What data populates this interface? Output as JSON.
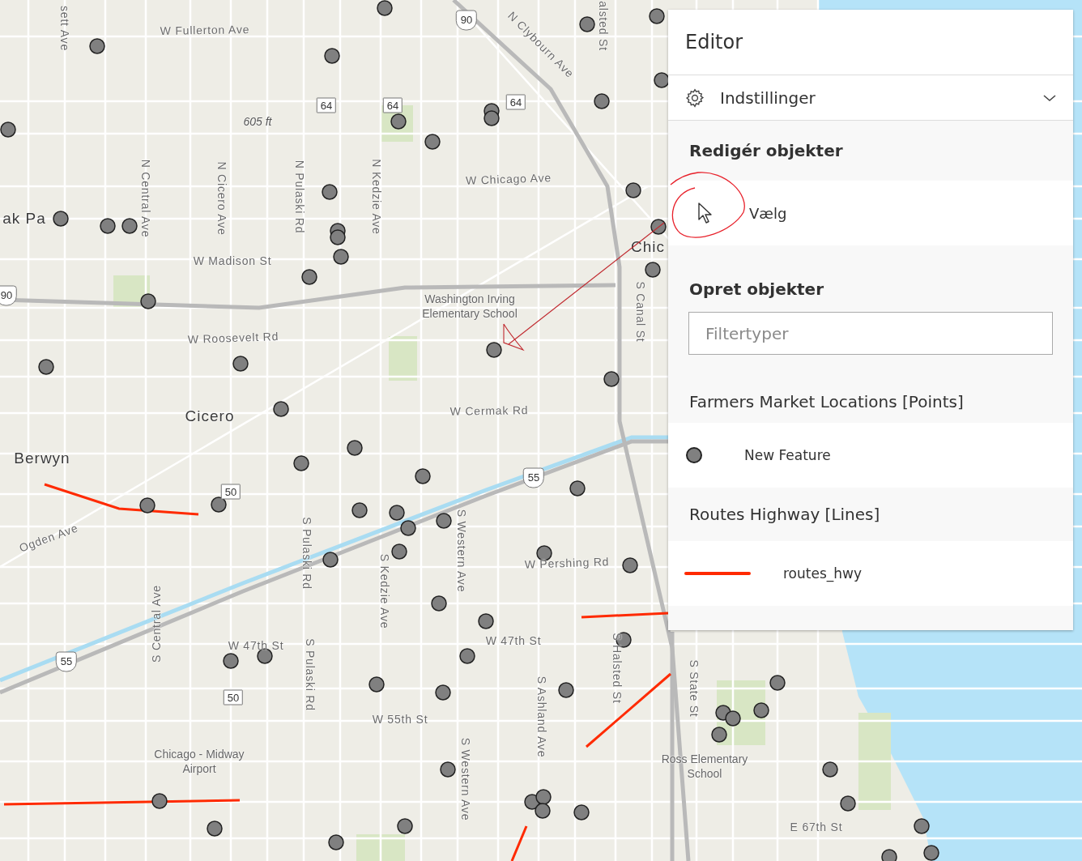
{
  "map": {
    "labels": [
      {
        "text": "sett Ave",
        "kind": "street"
      },
      {
        "text": "W Fullerton Ave",
        "kind": "street"
      },
      {
        "text": "N Clybourn Ave",
        "kind": "street"
      },
      {
        "text": "alsted St",
        "kind": "street"
      },
      {
        "text": "605 ft",
        "kind": "elevation"
      },
      {
        "text": "W Chicago Ave",
        "kind": "street"
      },
      {
        "text": "ak Pa",
        "kind": "place"
      },
      {
        "text": "N Central Ave",
        "kind": "street"
      },
      {
        "text": "N Cicero Ave",
        "kind": "street"
      },
      {
        "text": "N Pulaski Rd",
        "kind": "street"
      },
      {
        "text": "N Kedzie Ave",
        "kind": "street"
      },
      {
        "text": "W Madison St",
        "kind": "street"
      },
      {
        "text": "Washington Irving Elementary School",
        "kind": "poi"
      },
      {
        "text": "Chic",
        "kind": "place"
      },
      {
        "text": "S Canal St",
        "kind": "street"
      },
      {
        "text": "W Roosevelt Rd",
        "kind": "street"
      },
      {
        "text": "Cicero",
        "kind": "place"
      },
      {
        "text": "W Cermak Rd",
        "kind": "street"
      },
      {
        "text": "Berwyn",
        "kind": "place"
      },
      {
        "text": "Ogden Ave",
        "kind": "street"
      },
      {
        "text": "S Pulaski Rd",
        "kind": "street"
      },
      {
        "text": "S Kedzie Ave",
        "kind": "street"
      },
      {
        "text": "S Western Ave",
        "kind": "street"
      },
      {
        "text": "W Pershing Rd",
        "kind": "street"
      },
      {
        "text": "S Central Ave",
        "kind": "street"
      },
      {
        "text": "W 47th St",
        "kind": "street"
      },
      {
        "text": "S Pulaski Rd",
        "kind": "street"
      },
      {
        "text": "W 47th St",
        "kind": "street"
      },
      {
        "text": "S Halsted St",
        "kind": "street"
      },
      {
        "text": "S State St",
        "kind": "street"
      },
      {
        "text": "W 55th St",
        "kind": "street"
      },
      {
        "text": "S Ashland Ave",
        "kind": "street"
      },
      {
        "text": "S Western Ave",
        "kind": "street"
      },
      {
        "text": "Chicago - Midway Airport",
        "kind": "poi"
      },
      {
        "text": "Ross Elementary School",
        "kind": "poi"
      },
      {
        "text": "E 67th St",
        "kind": "street"
      }
    ],
    "shields": [
      {
        "text": "90",
        "kind": "interstate"
      },
      {
        "text": "64",
        "kind": "state"
      },
      {
        "text": "64",
        "kind": "state"
      },
      {
        "text": "64",
        "kind": "state"
      },
      {
        "text": "90",
        "kind": "interstate"
      },
      {
        "text": "55",
        "kind": "interstate"
      },
      {
        "text": "50",
        "kind": "state"
      },
      {
        "text": "55",
        "kind": "interstate"
      },
      {
        "text": "50",
        "kind": "state"
      }
    ]
  },
  "editor": {
    "title": "Editor",
    "settings": {
      "label": "Indstillinger",
      "expanded": false
    },
    "edit_section": {
      "heading": "Redigér objekter",
      "tools": [
        {
          "label": "Vælg"
        }
      ]
    },
    "create_section": {
      "heading": "Opret objekter",
      "filter": {
        "placeholder": "Filtertyper"
      },
      "layers": [
        {
          "name": "Farmers Market Locations [Points]",
          "templates": [
            {
              "label": "New Feature",
              "kind": "point"
            }
          ]
        },
        {
          "name": "Routes Highway [Lines]",
          "templates": [
            {
              "label": "routes_hwy",
              "kind": "line"
            }
          ]
        }
      ]
    }
  }
}
